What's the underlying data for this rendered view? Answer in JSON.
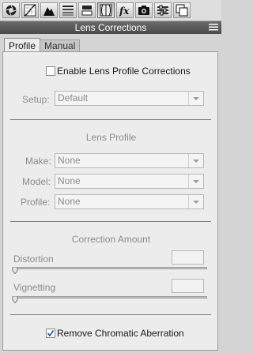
{
  "toolbar": {
    "icons": [
      "aperture-icon",
      "tone-curve-icon",
      "detail-icon",
      "hsl-icon",
      "split-toning-icon",
      "lens-corrections-icon",
      "effects-icon",
      "camera-calibration-icon",
      "presets-icon",
      "snapshots-icon"
    ],
    "active_index": 5
  },
  "panel": {
    "title": "Lens Corrections"
  },
  "tabs": [
    {
      "label": "Profile",
      "active": true
    },
    {
      "label": "Manual",
      "active": false
    }
  ],
  "profile": {
    "enable_label": "Enable Lens Profile Corrections",
    "enable_checked": false,
    "setup_label": "Setup:",
    "setup_value": "Default",
    "lens_profile_title": "Lens Profile",
    "make_label": "Make:",
    "make_value": "None",
    "model_label": "Model:",
    "model_value": "None",
    "profile_label": "Profile:",
    "profile_value": "None",
    "correction_title": "Correction Amount",
    "distortion_label": "Distortion",
    "distortion_value": "",
    "vignetting_label": "Vignetting",
    "vignetting_value": "",
    "chromatic_label": "Remove Chromatic Aberration",
    "chromatic_checked": true
  },
  "colors": {
    "header_bg": "#5a5a5a",
    "panel_bg": "#ececec",
    "dim_text": "#8c8c8c"
  }
}
